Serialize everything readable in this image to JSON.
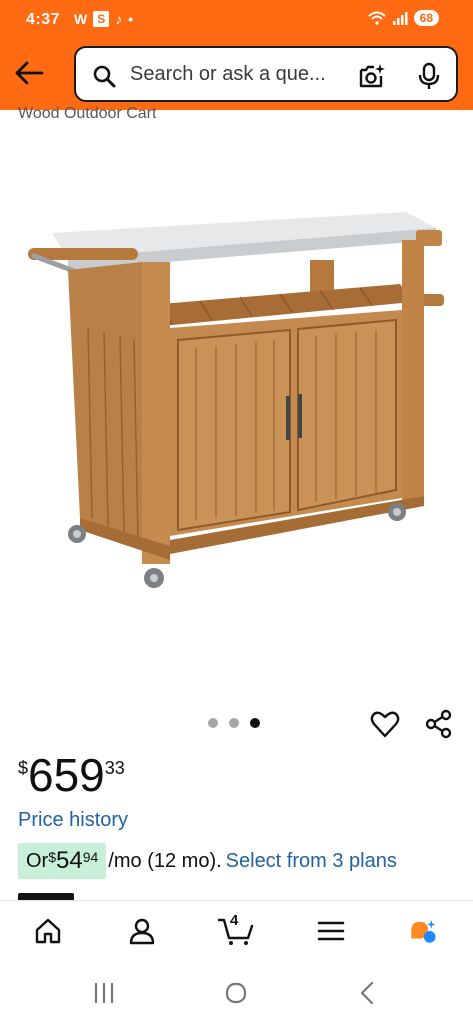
{
  "status_bar": {
    "time": "4:37",
    "icons": [
      "W",
      "S",
      "tiktok",
      "•"
    ],
    "battery": "68"
  },
  "search": {
    "placeholder": "Search or ask a que..."
  },
  "product": {
    "title_partial": "Wood Outdoor Cart",
    "image_alt": "Wood outdoor kitchen cart with stainless steel top",
    "carousel": {
      "count": 3,
      "active_index": 2
    }
  },
  "price": {
    "symbol": "$",
    "whole": "659",
    "fraction": "33"
  },
  "price_history_label": "Price history",
  "monthly": {
    "prefix": "Or ",
    "symbol": "$",
    "whole": "54",
    "fraction": "94",
    "suffix": "/mo (12 mo).",
    "plans_link": "Select from 3 plans"
  },
  "bottom_nav": {
    "cart_count": "4",
    "items": [
      "home",
      "account",
      "cart",
      "menu",
      "rufus"
    ]
  },
  "colors": {
    "header": "#ff6a13",
    "link": "#2162a1",
    "monthly_badge": "#c8f0d8"
  }
}
